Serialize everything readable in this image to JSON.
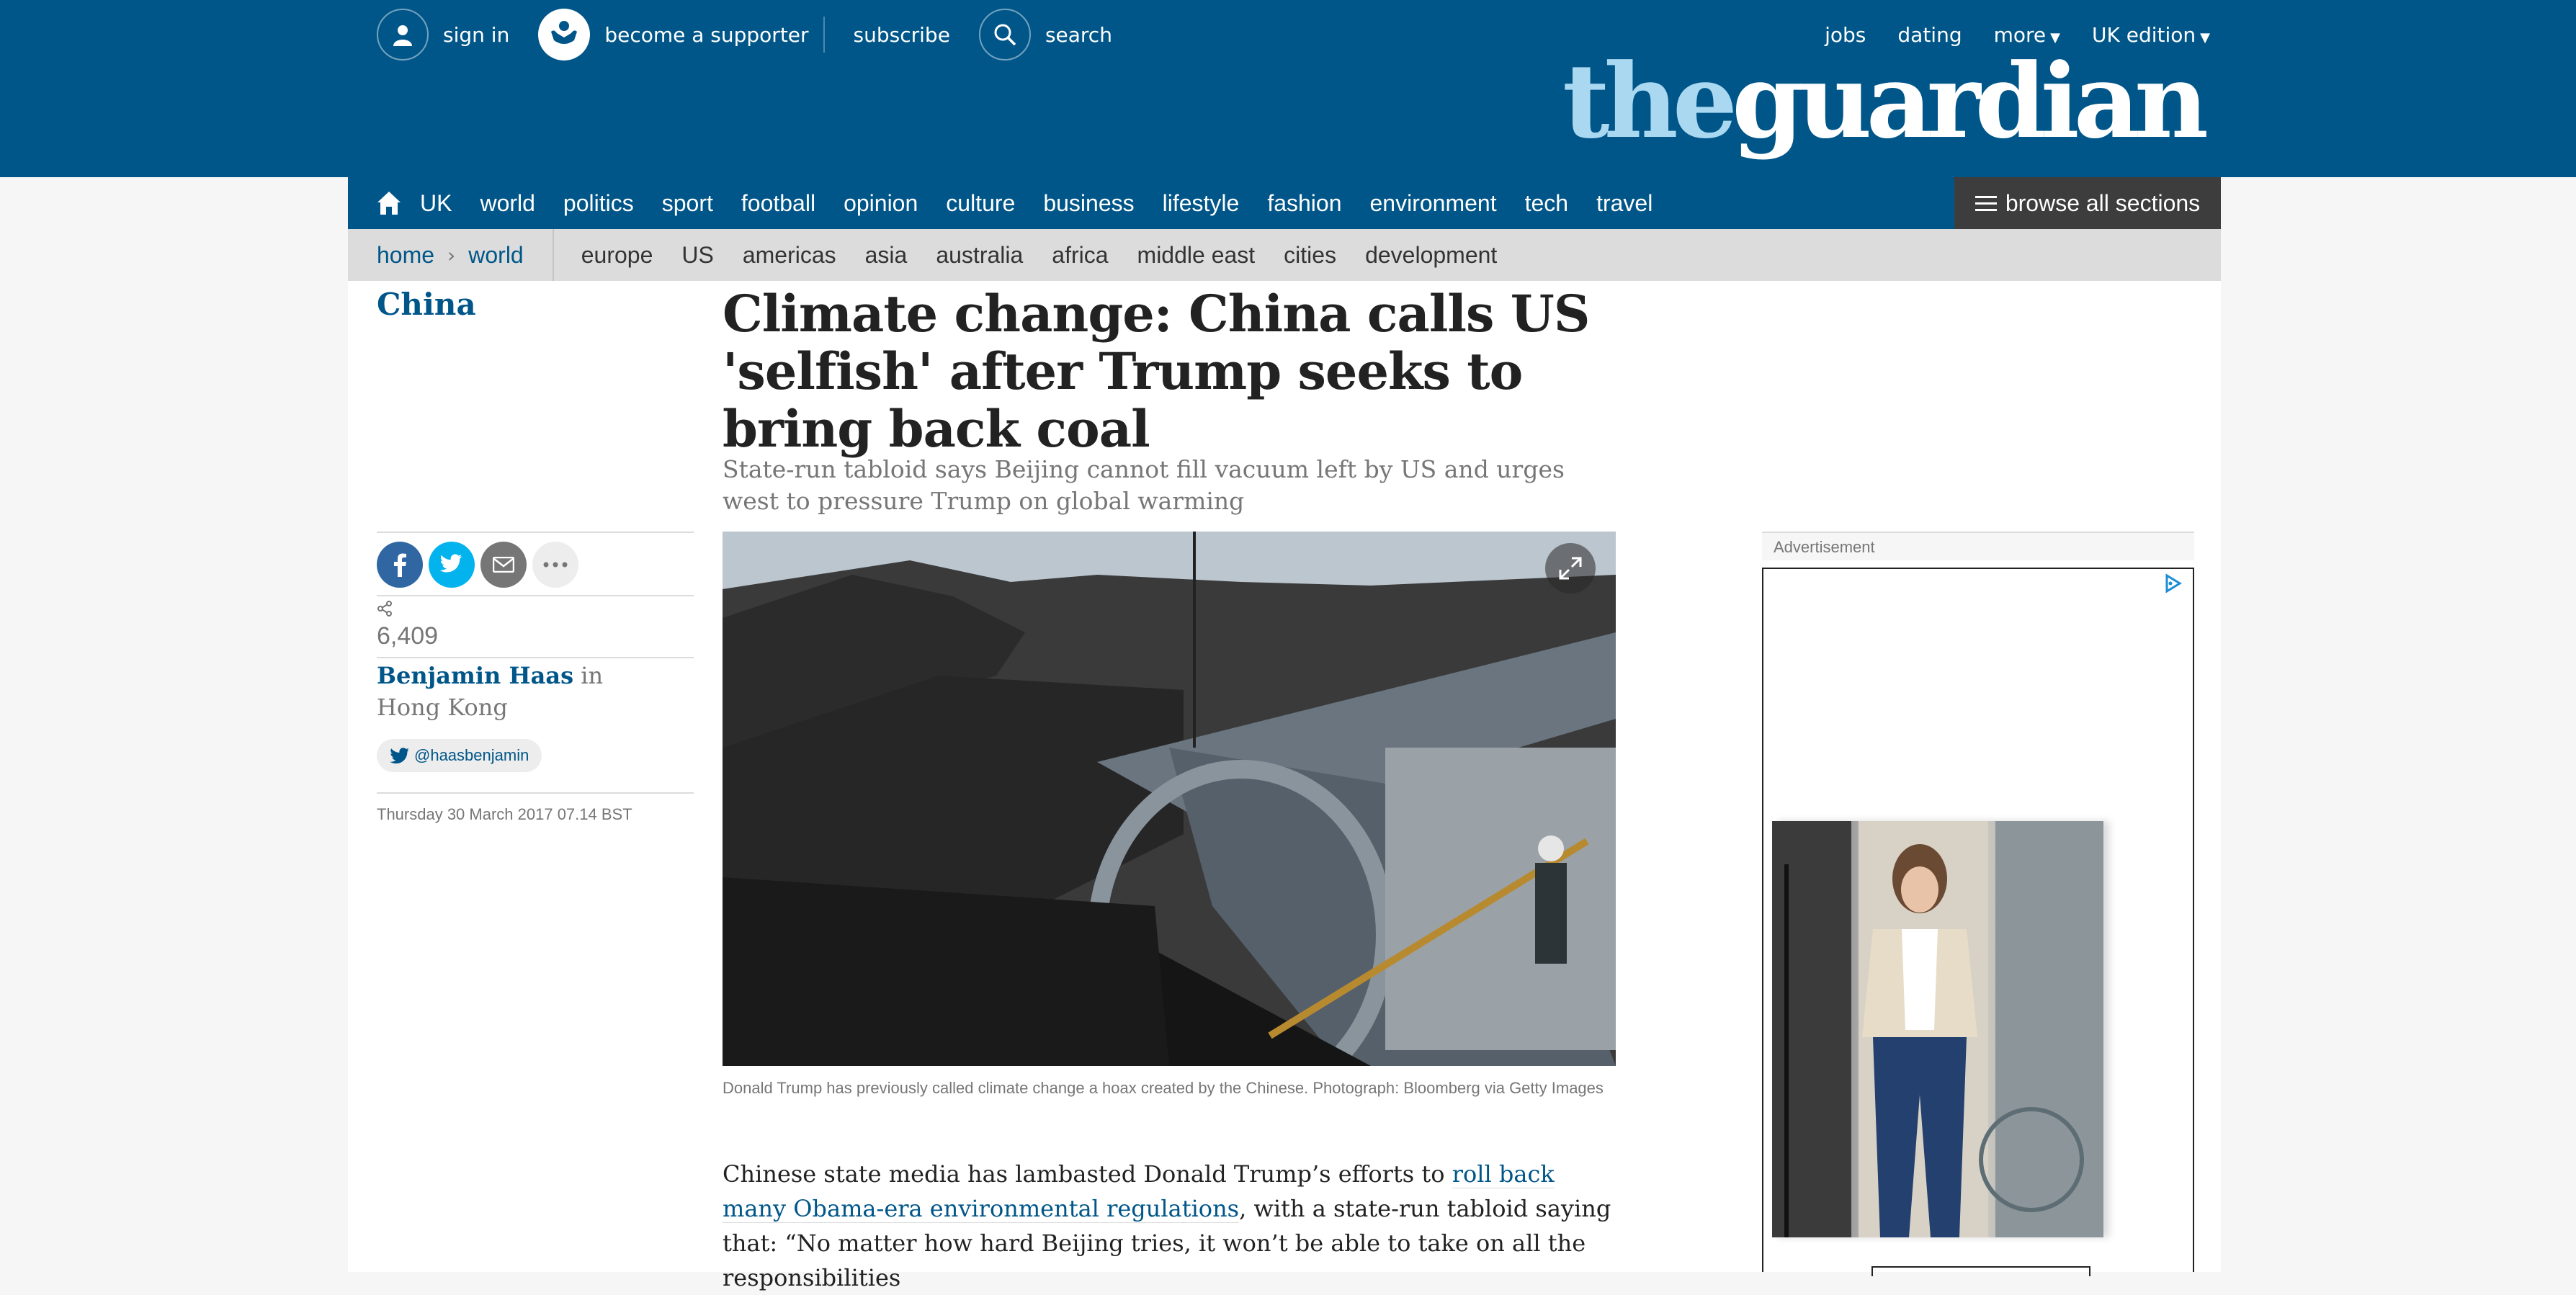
{
  "header": {
    "sign_in": "sign in",
    "become_supporter": "become a supporter",
    "subscribe": "subscribe",
    "search": "search",
    "right_links": [
      "jobs",
      "dating",
      "more",
      "UK edition"
    ],
    "logo_the": "the",
    "logo_guardian": "guardian"
  },
  "nav": {
    "items": [
      "UK",
      "world",
      "politics",
      "sport",
      "football",
      "opinion",
      "culture",
      "business",
      "lifestyle",
      "fashion",
      "environment",
      "tech",
      "travel"
    ],
    "browse_all": "browse all sections"
  },
  "subnav": {
    "breadcrumb": [
      "home",
      "world"
    ],
    "items": [
      "europe",
      "US",
      "americas",
      "asia",
      "australia",
      "africa",
      "middle east",
      "cities",
      "development"
    ]
  },
  "article": {
    "series": "China",
    "headline": "Climate change: China calls US 'selfish' after Trump seeks to bring back coal",
    "standfirst": "State-run tabloid says Beijing cannot fill vacuum left by US and urges west to pressure Trump on global warming",
    "share_count": "6,409",
    "author": "Benjamin Haas",
    "location": " in Hong Kong",
    "twitter": "@haasbenjamin",
    "dateline": "Thursday 30 March 2017 07.14 BST",
    "caption": "Donald Trump has previously called climate change a hoax created by the Chinese. Photograph: Bloomberg via Getty Images",
    "body_intro": "Chinese state media has lambasted Donald Trump’s efforts to ",
    "body_link": "roll back many Obama-era environmental regulations",
    "body_rest": ", with a state-run tabloid saying that: “No matter how hard Beijing tries, it won’t be able to take on all the responsibilities"
  },
  "ad": {
    "label": "Advertisement"
  },
  "colors": {
    "brand_blue": "#005689",
    "logo_light": "#aad8f1",
    "facebook": "#3067a3",
    "twitter": "#03b3ee",
    "email": "#767676"
  }
}
